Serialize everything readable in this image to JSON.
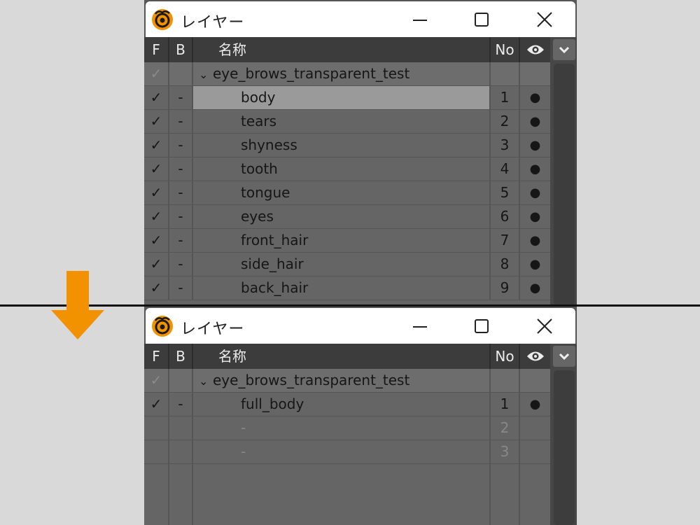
{
  "colors": {
    "accent_arrow": "#f39200",
    "panel_bg": "#656565",
    "header_bg": "#3c3c3c",
    "selected_row": "#9a9a9a"
  },
  "panels": [
    {
      "title": "レイヤー",
      "headers": {
        "f": "F",
        "b": "B",
        "name": "名称",
        "no": "No",
        "eye_icon": "eye-icon"
      },
      "group": {
        "check": "✓",
        "chevron": "❯",
        "name": "eye_brows_transparent_test"
      },
      "layers": [
        {
          "check": "✓",
          "b": "-",
          "name": "body",
          "no": "1",
          "eye": "●",
          "selected": true
        },
        {
          "check": "✓",
          "b": "-",
          "name": "tears",
          "no": "2",
          "eye": "●"
        },
        {
          "check": "✓",
          "b": "-",
          "name": "shyness",
          "no": "3",
          "eye": "●"
        },
        {
          "check": "✓",
          "b": "-",
          "name": "tooth",
          "no": "4",
          "eye": "●"
        },
        {
          "check": "✓",
          "b": "-",
          "name": "tongue",
          "no": "5",
          "eye": "●"
        },
        {
          "check": "✓",
          "b": "-",
          "name": "eyes",
          "no": "6",
          "eye": "●"
        },
        {
          "check": "✓",
          "b": "-",
          "name": "front_hair",
          "no": "7",
          "eye": "●"
        },
        {
          "check": "✓",
          "b": "-",
          "name": "side_hair",
          "no": "8",
          "eye": "●"
        },
        {
          "check": "✓",
          "b": "-",
          "name": "back_hair",
          "no": "9",
          "eye": "●"
        }
      ]
    },
    {
      "title": "レイヤー",
      "headers": {
        "f": "F",
        "b": "B",
        "name": "名称",
        "no": "No",
        "eye_icon": "eye-icon"
      },
      "group": {
        "check": "✓",
        "chevron": "❯",
        "name": "eye_brows_transparent_test"
      },
      "layers": [
        {
          "check": "✓",
          "b": "-",
          "name": "full_body",
          "no": "1",
          "eye": "●"
        },
        {
          "check": "",
          "b": "",
          "name": "-",
          "no": "2",
          "eye": "",
          "empty": true
        },
        {
          "check": "",
          "b": "",
          "name": "-",
          "no": "3",
          "eye": "",
          "empty": true
        }
      ]
    }
  ]
}
